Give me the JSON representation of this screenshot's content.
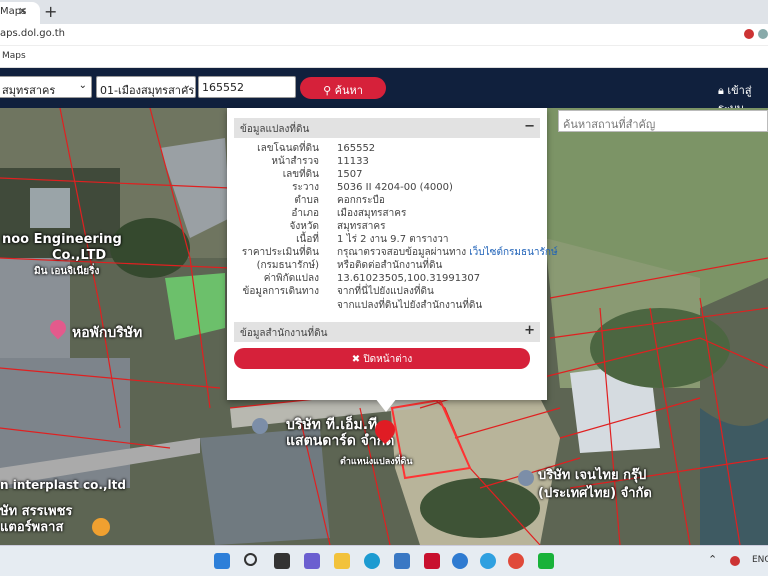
{
  "browser": {
    "tab_title": "Maps",
    "url": "aps.dol.go.th",
    "bookmark": "Maps"
  },
  "header": {
    "province": "สมุทรสาคร",
    "district": "01-เมืองสมุทรสาคร",
    "parcel_no": "165552",
    "search_label": "ค้นหา",
    "login_label": "เข้าสู่ระบบ"
  },
  "place_search": {
    "placeholder": "ค้นหาสถานที่สำคัญ"
  },
  "panel": {
    "section1_title": "ข้อมูลแปลงที่ดิน",
    "section1_toggle": "−",
    "rows": [
      {
        "label": "เลขโฉนดที่ดิน",
        "value": "165552"
      },
      {
        "label": "หน้าสำรวจ",
        "value": "11133"
      },
      {
        "label": "เลขที่ดิน",
        "value": "1507"
      },
      {
        "label": "ระวาง",
        "value": "5036 II 4204-00 (4000)"
      },
      {
        "label": "ตำบล",
        "value": "คอกกระบือ"
      },
      {
        "label": "อำเภอ",
        "value": "เมืองสมุทรสาคร"
      },
      {
        "label": "จังหวัด",
        "value": "สมุทรสาคร"
      },
      {
        "label": "เนื้อที่",
        "value": "1 ไร่ 2 งาน 9.7 ตารางวา"
      }
    ],
    "price_label": "ราคาประเมินที่ดิน",
    "price_text": "กรุณาตรวจสอบข้อมูลผ่านทาง",
    "price_link": "เว็บไซต์กรมธนารักษ์",
    "price_sub_label": "(กรมธนารักษ์)",
    "price_sub_text": "หรือติดต่อสำนักงานที่ดิน",
    "coord_label": "ค่าพิกัดแปลง",
    "coord_value": "13.61023505,100.31991307",
    "travel_label": "ข้อมูลการเดินทาง",
    "travel_link1": "จากที่นี่ไปยังแปลงที่ดิน",
    "travel_link2": "จากแปลงที่ดินไปยังสำนักงานที่ดิน",
    "section2_title": "ข้อมูลสำนักงานที่ดิน",
    "section2_toggle": "+",
    "close_label": "✖ ปิดหน้าต่าง"
  },
  "map_labels": {
    "engineering": "noo Engineering",
    "engineering2": "Co.,LTD",
    "engineering3": "มิน เอนจิเนียริ่ง",
    "dorm": "หอพักบริษัท",
    "bst1": "บริษัท ที.เอ็ม.ที",
    "bst2": "แสตนดาร์ด จำกัด",
    "parcel_marker": "ตำแหน่งแปลงที่ดิน",
    "interplast": "n interplast co.,ltd",
    "surapong1": "ษัท สรรเพชร",
    "surapong2": "แตอร์พลาส",
    "genthai1": "บริษัท เจนไทย กรุ๊ป",
    "genthai2": "(ประเทศไทย) จำกัด"
  },
  "taskbar": {
    "lang": "ENG"
  }
}
